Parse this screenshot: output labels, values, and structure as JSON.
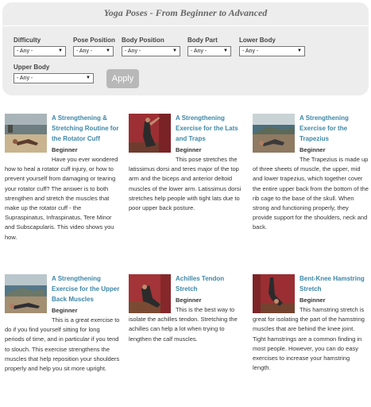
{
  "page_title": "Yoga Poses - From Beginner to Advanced",
  "filters": {
    "difficulty": {
      "label": "Difficulty",
      "value": "- Any -"
    },
    "pose_position": {
      "label": "Pose Position",
      "value": "- Any -"
    },
    "body_position": {
      "label": "Body Position",
      "value": "- Any -"
    },
    "body_part": {
      "label": "Body Part",
      "value": "- Any -"
    },
    "lower_body": {
      "label": "Lower Body",
      "value": "- Any -"
    },
    "upper_body": {
      "label": "Upper Body",
      "value": "- Any -"
    }
  },
  "apply_label": "Apply",
  "icons": {
    "dropdown": "chevron-down-icon"
  },
  "colors": {
    "link": "#3d87a6",
    "panel_bg": "#ededed",
    "button_bg": "#b8b8b8"
  },
  "cards": [
    {
      "title": "A Strengthening & Stretching Routine for the Rotator Cuff",
      "level": "Beginner",
      "description": "Have you ever wondered how to heal a rotator cuff injury, or how to prevent yourself from damaging or tearing your rotator cuff? The answer is to both strengthen and stretch the muscles that make up the rotator cuff - the Supraspinatus, Infraspinatus, Tere Minor and Subscapularis. This video shows you how."
    },
    {
      "title": "A Strengthening Exercise for the Lats and Traps",
      "level": "Beginner",
      "description": "This pose stretches the latissimus dorsi and teres major of the top arm and the biceps and anterior deltoid muscles of the lower arm. Latissimus dorsi stretches help people with tight lats due to poor upper back posture."
    },
    {
      "title": "A Strengthening Exercise for the Trapezius",
      "level": "Beginner",
      "description": "The Trapezius is made up of three sheets of muscle, the upper, mid and lower trapezius, which together cover the entire upper back from the bottom of the rib cage to the base of the skull. When strong and functioning properly, they provide support for the shoulders, neck and back."
    },
    {
      "title": "A Strengthening Exercise for the Upper Back Muscles",
      "level": "Beginner",
      "description": "This is a great exercise to do if you find yourself sitting for long periods of time, and in particular if you tend to slouch. This exercise strengthens the muscles that help reposition your shoulders properly and help you sit more upright."
    },
    {
      "title": "Achilles Tendon Stretch",
      "level": "Beginner",
      "description": "This is the best way to isolate the achilles tendon. Stretching the achilles can help a lot when trying to lengthen the calf muscles."
    },
    {
      "title": "Bent-Knee Hamstring Stretch",
      "level": "Beginner",
      "description": "This hamstring stretch is great for isolating the part of the hamstring muscles that are behind the knee joint. Tight hamstrings are a common finding in most people. However, you can do easy exercises to increase your hamstring length."
    }
  ]
}
